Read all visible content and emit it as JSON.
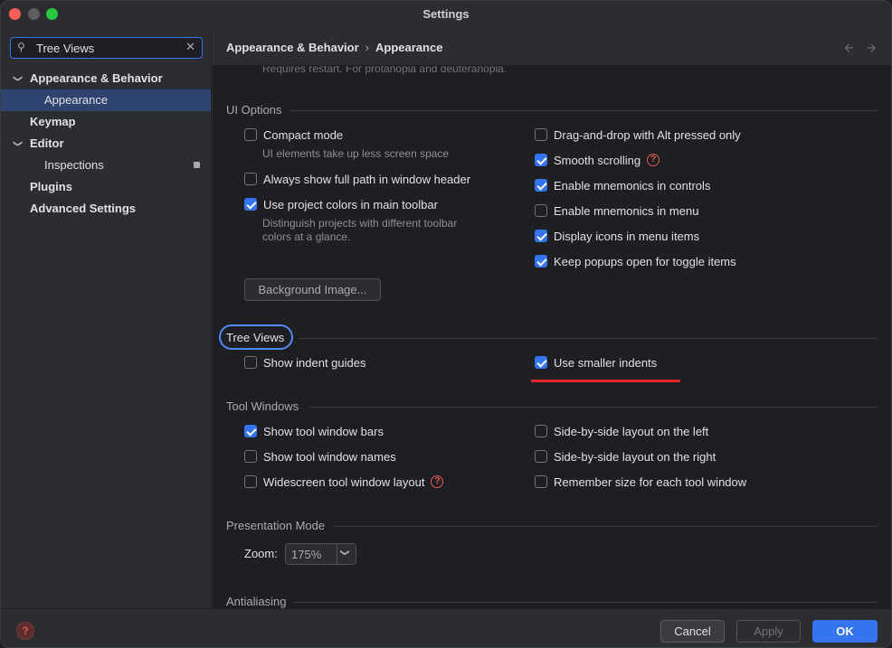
{
  "window": {
    "title": "Settings"
  },
  "search": {
    "value": "Tree Views"
  },
  "sidebar": {
    "items": [
      {
        "label": "Appearance & Behavior"
      },
      {
        "label": "Appearance"
      },
      {
        "label": "Keymap"
      },
      {
        "label": "Editor"
      },
      {
        "label": "Inspections"
      },
      {
        "label": "Plugins"
      },
      {
        "label": "Advanced Settings"
      }
    ]
  },
  "header": {
    "crumb_parent": "Appearance & Behavior",
    "crumb_separator": "›",
    "crumb_current": "Appearance"
  },
  "content": {
    "faded_text": "Requires restart. For protanopia and deuteranopia.",
    "ui_options": {
      "title": "UI Options",
      "compact_mode": {
        "label": "Compact mode",
        "checked": false,
        "hint": "UI elements take up less screen space"
      },
      "full_path": {
        "label": "Always show full path in window header",
        "checked": false
      },
      "project_colors": {
        "label": "Use project colors in main toolbar",
        "checked": true,
        "hint_line1": "Distinguish projects with different toolbar",
        "hint_line2": "colors at a glance."
      },
      "drag_drop": {
        "label": "Drag-and-drop with Alt pressed only",
        "checked": false
      },
      "smooth_scrolling": {
        "label": "Smooth scrolling",
        "checked": true
      },
      "mnemonics_controls": {
        "label": "Enable mnemonics in controls",
        "checked": true
      },
      "mnemonics_menu": {
        "label": "Enable mnemonics in menu",
        "checked": false
      },
      "icons_menu": {
        "label": "Display icons in menu items",
        "checked": true
      },
      "keep_popups": {
        "label": "Keep popups open for toggle items",
        "checked": true
      },
      "background_image_button": "Background Image..."
    },
    "tree_views": {
      "title": "Tree Views",
      "indent_guides": {
        "label": "Show indent guides",
        "checked": false
      },
      "smaller_indents": {
        "label": "Use smaller indents",
        "checked": true
      }
    },
    "tool_windows": {
      "title": "Tool Windows",
      "show_bars": {
        "label": "Show tool window bars",
        "checked": true
      },
      "show_names": {
        "label": "Show tool window names",
        "checked": false
      },
      "widescreen": {
        "label": "Widescreen tool window layout",
        "checked": false
      },
      "side_left": {
        "label": "Side-by-side layout on the left",
        "checked": false
      },
      "side_right": {
        "label": "Side-by-side layout on the right",
        "checked": false
      },
      "remember_size": {
        "label": "Remember size for each tool window",
        "checked": false
      }
    },
    "presentation": {
      "title": "Presentation Mode",
      "zoom_label": "Zoom:",
      "zoom_value": "175%"
    },
    "antialiasing": {
      "title": "Antialiasing"
    }
  },
  "footer": {
    "help_glyph": "?",
    "cancel": "Cancel",
    "apply": "Apply",
    "ok": "OK"
  },
  "colors": {
    "accent": "#3574f0",
    "highlight_ring": "#548af7",
    "annotation_underline": "#e5252a"
  }
}
